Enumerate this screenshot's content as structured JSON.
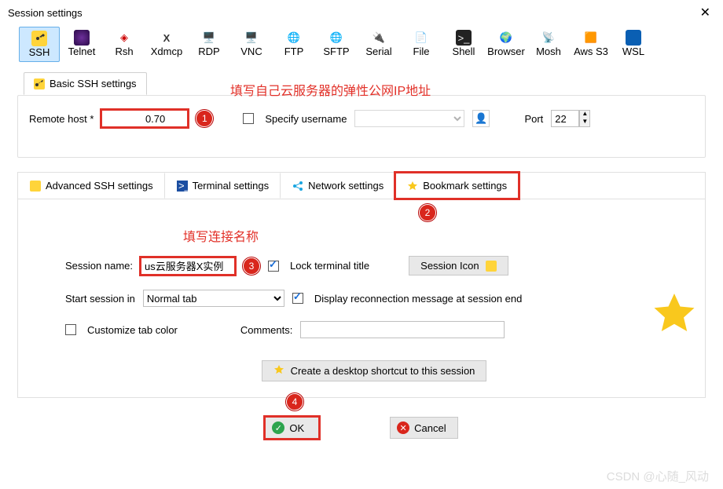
{
  "window": {
    "title": "Session settings",
    "close": "✕"
  },
  "toolbar": [
    {
      "label": "SSH",
      "selected": true
    },
    {
      "label": "Telnet"
    },
    {
      "label": "Rsh"
    },
    {
      "label": "Xdmcp"
    },
    {
      "label": "RDP"
    },
    {
      "label": "VNC"
    },
    {
      "label": "FTP"
    },
    {
      "label": "SFTP"
    },
    {
      "label": "Serial"
    },
    {
      "label": "File"
    },
    {
      "label": "Shell"
    },
    {
      "label": "Browser"
    },
    {
      "label": "Mosh"
    },
    {
      "label": "Aws S3"
    },
    {
      "label": "WSL"
    }
  ],
  "basic": {
    "tab": "Basic SSH settings",
    "anno": "填写自己云服务器的弹性公网IP地址",
    "remoteHostLabel": "Remote host *",
    "remoteHostValue": "              0.70",
    "marker": "1",
    "specifyUser": "Specify username",
    "portLabel": "Port",
    "portValue": "22"
  },
  "tabs2": [
    {
      "label": "Advanced SSH settings",
      "icon": "key"
    },
    {
      "label": "Terminal settings",
      "icon": "terminal"
    },
    {
      "label": "Network settings",
      "icon": "net"
    },
    {
      "label": "Bookmark settings",
      "icon": "star",
      "selected": true
    }
  ],
  "markers": {
    "tab": "2",
    "name": "3",
    "ok": "4"
  },
  "bookmark": {
    "anno": "填写连接名称",
    "sessionNameLabel": "Session name:",
    "sessionNameValue": "us云服务器X实例",
    "lockTitle": "Lock terminal title",
    "sessionIconBtn": "Session Icon",
    "startLabel": "Start session in",
    "startOption": "Normal tab",
    "displayReconn": "Display reconnection message at session end",
    "customizeTab": "Customize tab color",
    "commentsLabel": "Comments:",
    "commentsValue": "",
    "shortcutBtn": "Create a desktop shortcut to this session"
  },
  "footer": {
    "ok": "OK",
    "cancel": "Cancel"
  },
  "watermark": "CSDN @心随_风动"
}
